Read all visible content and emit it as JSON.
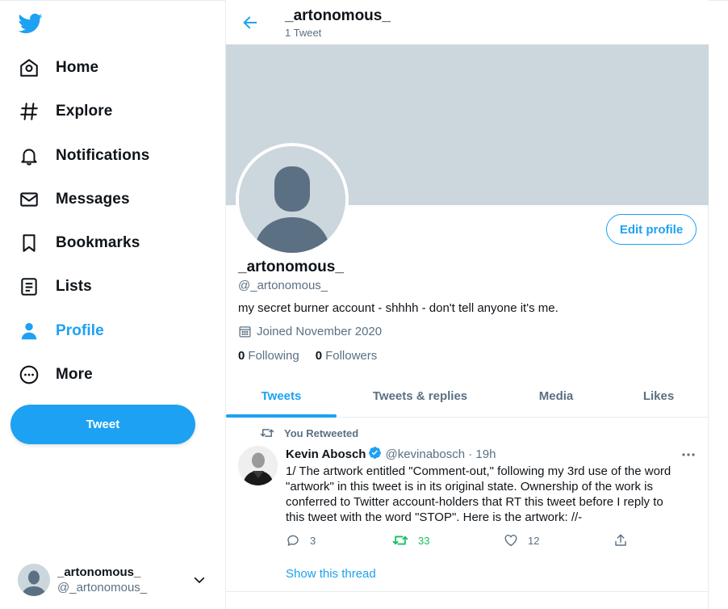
{
  "nav": [
    {
      "label": "Home",
      "icon": "home-icon"
    },
    {
      "label": "Explore",
      "icon": "hashtag-icon"
    },
    {
      "label": "Notifications",
      "icon": "bell-icon"
    },
    {
      "label": "Messages",
      "icon": "envelope-icon"
    },
    {
      "label": "Bookmarks",
      "icon": "bookmark-icon"
    },
    {
      "label": "Lists",
      "icon": "list-icon"
    },
    {
      "label": "Profile",
      "icon": "person-icon"
    },
    {
      "label": "More",
      "icon": "more-circle-icon"
    }
  ],
  "sidebar": {
    "tweet_label": "Tweet",
    "account": {
      "name": "_artonomous_",
      "handle": "@_artonomous_"
    }
  },
  "header": {
    "title": "_artonomous_",
    "subtitle": "1 Tweet"
  },
  "profile": {
    "name": "_artonomous_",
    "handle": "@_artonomous_",
    "edit_label": "Edit profile",
    "bio": "my secret burner account - shhhh - don't tell anyone it's me.",
    "joined": "Joined November 2020",
    "following_count": "0",
    "following_label": "Following",
    "followers_count": "0",
    "followers_label": "Followers"
  },
  "tabs": [
    "Tweets",
    "Tweets & replies",
    "Media",
    "Likes"
  ],
  "tweet": {
    "retweet_context": "You Retweeted",
    "author": "Kevin Abosch",
    "meta": "@kevinabosch · 19h",
    "lines": [
      "1/ The artwork entitled \"Comment-out,\" following my 3rd use of the word",
      "\"artwork\" in this tweet is in its original state. Ownership of the work is",
      "conferred to Twitter account-holders that RT this tweet before I reply to",
      "this tweet with the word \"STOP\". Here is the artwork:  //-"
    ],
    "replies": "3",
    "retweets": "33",
    "likes": "12",
    "show_thread": "Show this thread"
  },
  "colors": {
    "accent": "#1da1f2",
    "banner": "#ccd6dd",
    "secondary_text": "#5b7083",
    "retweet_green": "#17bf63"
  }
}
